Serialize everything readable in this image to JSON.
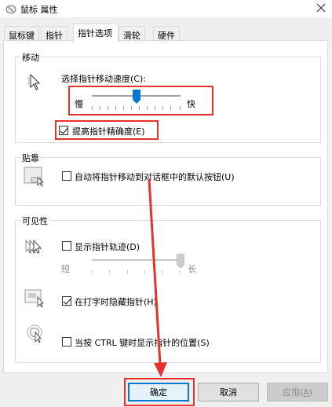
{
  "window": {
    "title": "鼠标 属性",
    "close_icon": "close-icon"
  },
  "tabs": [
    {
      "label": "鼠标键"
    },
    {
      "label": "指针"
    },
    {
      "label": "指针选项",
      "active": true
    },
    {
      "label": "滑轮"
    },
    {
      "label": "硬件"
    }
  ],
  "motion": {
    "group_title": "移动",
    "speed_label": "选择指针移动速度(C):",
    "slow": "慢",
    "fast": "快",
    "speed_level": 0.5,
    "precision_label": "提高指针精确度(E)",
    "precision_checked": true
  },
  "snap": {
    "group_title": "贴靠",
    "label": "自动将指针移动到对话框中的默认按钮(U)",
    "checked": false
  },
  "visibility": {
    "group_title": "可见性",
    "trails_label": "显示指针轨迹(D)",
    "trails_checked": false,
    "short": "短",
    "long": "长",
    "trails_level": 1.0,
    "hide_label": "在打字时隐藏指针(H)",
    "hide_checked": true,
    "ctrl_label": "当按 CTRL 键时显示指针的位置(S)",
    "ctrl_checked": false
  },
  "buttons": {
    "ok": "确定",
    "cancel": "取消",
    "apply_prefix": "应用(",
    "apply_key": "A",
    "apply_suffix": ")"
  },
  "colors": {
    "highlight": "#e5322d",
    "accent": "#0078d7"
  }
}
